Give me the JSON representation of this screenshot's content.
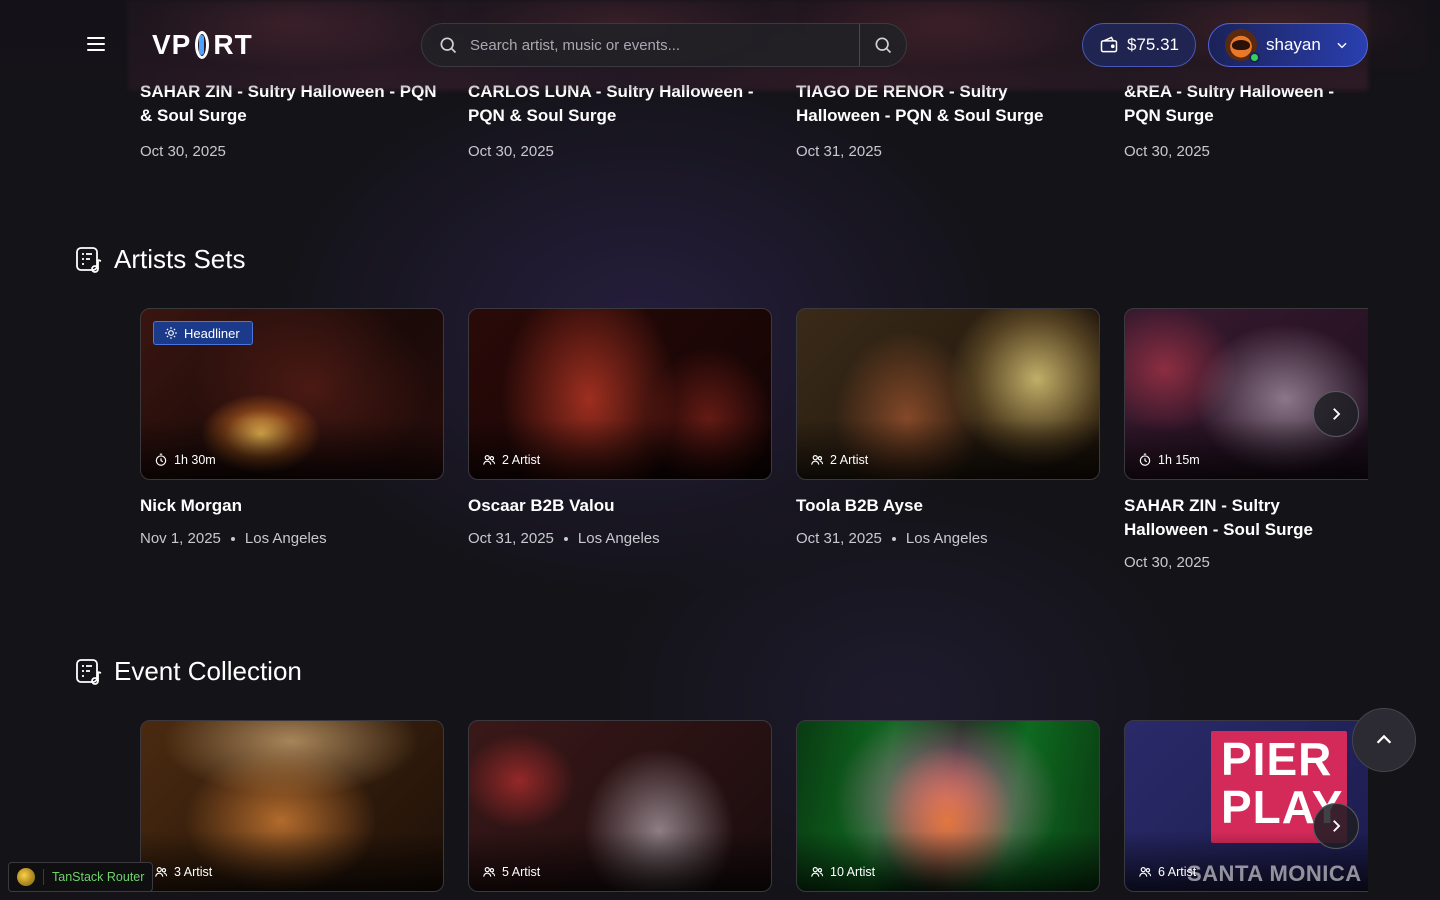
{
  "header": {
    "logo": "VPORT",
    "logo_parts": [
      "VP",
      "RT"
    ],
    "search_placeholder": "Search artist, music or events...",
    "wallet_balance": "$75.31",
    "username": "shayan"
  },
  "previous_row": [
    {
      "title": "SAHAR ZIN - Sultry Halloween - PQN & Soul Surge",
      "date": "Oct 30, 2025"
    },
    {
      "title": "CARLOS LUNA - Sultry Halloween - PQN & Soul Surge",
      "date": "Oct 30, 2025"
    },
    {
      "title": "TIAGO DE RENOR - Sultry Halloween - PQN & Soul Surge",
      "date": "Oct 31, 2025"
    },
    {
      "title": "&REA - Sultry Halloween - PQN Surge",
      "date": "Oct 30, 2025"
    }
  ],
  "artists_sets": {
    "title": "Artists Sets",
    "cards": [
      {
        "badge": "Headliner",
        "meta": "1h 30m",
        "meta_icon": "clock-icon",
        "title": "Nick Morgan",
        "date": "Nov 1, 2025",
        "location": "Los Angeles"
      },
      {
        "meta": "2 Artist",
        "meta_icon": "users-icon",
        "title": "Oscaar B2B Valou",
        "date": "Oct 31, 2025",
        "location": "Los Angeles"
      },
      {
        "meta": "2 Artist",
        "meta_icon": "users-icon",
        "title": "Toola B2B Ayse",
        "date": "Oct 31, 2025",
        "location": "Los Angeles"
      },
      {
        "meta": "1h 15m",
        "meta_icon": "clock-icon",
        "title": "SAHAR ZIN - Sultry Halloween - Soul Surge",
        "date": "Oct 30, 2025"
      }
    ]
  },
  "event_collection": {
    "title": "Event Collection",
    "cards": [
      {
        "meta": "3 Artist"
      },
      {
        "meta": "5 Artist"
      },
      {
        "meta": "10 Artist"
      },
      {
        "meta": "6 Artist",
        "poster_text": "PIER PLAY",
        "poster_sub": "SANTA MONICA PIER"
      }
    ]
  },
  "devtools": {
    "label": "TanStack Router"
  },
  "colors": {
    "accent": "#2a3fb0",
    "badge": "#1b3a8a",
    "online": "#32d25a",
    "devtools_text": "#6fd16a"
  }
}
